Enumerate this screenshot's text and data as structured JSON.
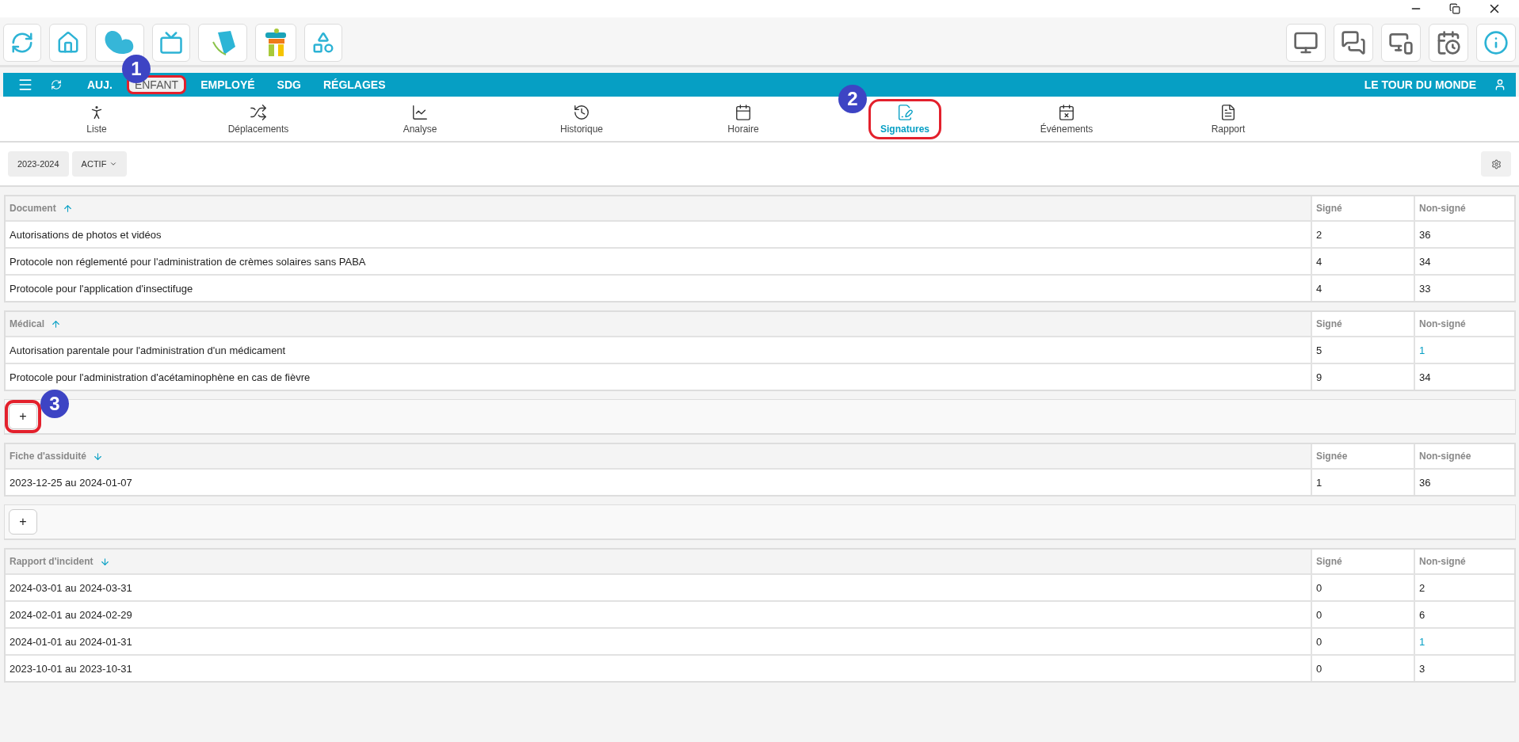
{
  "nav": {
    "items": [
      {
        "label": "AUJ.",
        "selected": false,
        "highlighted": false
      },
      {
        "label": "ENFANT",
        "selected": true,
        "highlighted": true,
        "callout": "1"
      },
      {
        "label": "EMPLOYÉ",
        "selected": false,
        "highlighted": false
      },
      {
        "label": "SDG",
        "selected": false,
        "highlighted": false
      },
      {
        "label": "RÉGLAGES",
        "selected": false,
        "highlighted": false
      }
    ],
    "organization": "LE TOUR DU MONDE"
  },
  "tabs": [
    {
      "label": "Liste",
      "selected": false,
      "highlighted": false
    },
    {
      "label": "Déplacements",
      "selected": false,
      "highlighted": false
    },
    {
      "label": "Analyse",
      "selected": false,
      "highlighted": false
    },
    {
      "label": "Historique",
      "selected": false,
      "highlighted": false
    },
    {
      "label": "Horaire",
      "selected": false,
      "highlighted": false
    },
    {
      "label": "Signatures",
      "selected": true,
      "highlighted": true,
      "callout": "2"
    },
    {
      "label": "Événements",
      "selected": false,
      "highlighted": false
    },
    {
      "label": "Rapport",
      "selected": false,
      "highlighted": false
    }
  ],
  "filters": [
    {
      "label": "2023-2024",
      "kind": "plain"
    },
    {
      "label": "ACTIF",
      "kind": "dropdown"
    }
  ],
  "sections": [
    {
      "kind": "table",
      "columns": [
        {
          "label": "Document",
          "sort_ascending": true
        },
        {
          "label": "Signé"
        },
        {
          "label": "Non-signé"
        }
      ],
      "rows": [
        {
          "cells": [
            "Autorisations de photos et vidéos",
            "2",
            "36"
          ],
          "unsigned_link": false
        },
        {
          "cells": [
            "Protocole non réglementé pour l'administration de crèmes solaires sans PABA",
            "4",
            "34"
          ],
          "unsigned_link": false
        },
        {
          "cells": [
            "Protocole pour l'application d'insectifuge",
            "4",
            "33"
          ],
          "unsigned_link": false
        }
      ]
    },
    {
      "kind": "table",
      "columns": [
        {
          "label": "Médical",
          "sort_ascending": true
        },
        {
          "label": "Signé"
        },
        {
          "label": "Non-signé"
        }
      ],
      "rows": [
        {
          "cells": [
            "Autorisation parentale pour l'administration d'un médicament",
            "5",
            "1"
          ],
          "unsigned_link": true
        },
        {
          "cells": [
            "Protocole pour l'administration d'acétaminophène en cas de fièvre",
            "9",
            "34"
          ],
          "unsigned_link": false
        }
      ]
    },
    {
      "kind": "add_bar",
      "button": "+",
      "highlighted": true,
      "callout": "3"
    },
    {
      "kind": "table",
      "columns": [
        {
          "label": "Fiche d'assiduité",
          "sort_ascending": false
        },
        {
          "label": "Signée"
        },
        {
          "label": "Non-signée"
        }
      ],
      "rows": [
        {
          "cells": [
            "2023-12-25 au 2024-01-07",
            "1",
            "36"
          ],
          "unsigned_link": false
        }
      ]
    },
    {
      "kind": "add_bar",
      "button": "+",
      "highlighted": false
    },
    {
      "kind": "table",
      "columns": [
        {
          "label": "Rapport d'incident",
          "sort_ascending": false
        },
        {
          "label": "Signé"
        },
        {
          "label": "Non-signé"
        }
      ],
      "rows": [
        {
          "cells": [
            "2024-03-01 au 2024-03-31",
            "0",
            "2"
          ],
          "unsigned_link": false
        },
        {
          "cells": [
            "2024-02-01 au 2024-02-29",
            "0",
            "6"
          ],
          "unsigned_link": false
        },
        {
          "cells": [
            "2024-01-01 au 2024-01-31",
            "0",
            "1"
          ],
          "unsigned_link": true
        },
        {
          "cells": [
            "2023-10-01 au 2023-10-31",
            "0",
            "3"
          ],
          "unsigned_link": false
        }
      ]
    }
  ]
}
